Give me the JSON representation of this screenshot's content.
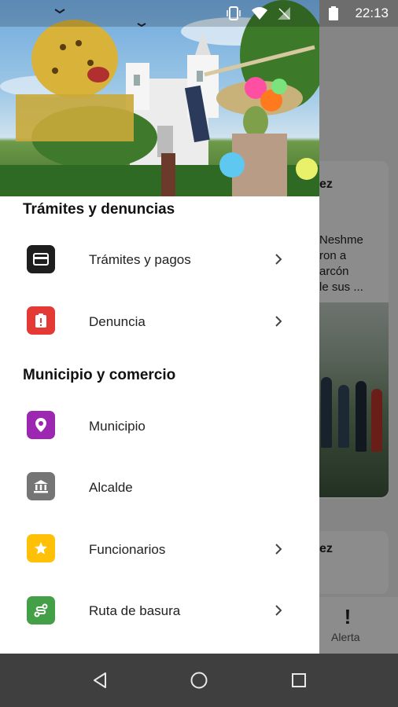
{
  "status_bar": {
    "time": "22:13"
  },
  "drawer": {
    "sections": [
      {
        "title": "Trámites y denuncias",
        "items": [
          {
            "label": "Trámites y pagos",
            "icon": "card-icon",
            "color": "#1e1e1e",
            "has_chevron": true
          },
          {
            "label": "Denuncia",
            "icon": "clipboard-alert-icon",
            "color": "#e53935",
            "has_chevron": true
          }
        ]
      },
      {
        "title": "Municipio y comercio",
        "items": [
          {
            "label": "Municipio",
            "icon": "location-pin-icon",
            "color": "#9c27b0",
            "has_chevron": false
          },
          {
            "label": "Alcalde",
            "icon": "bank-icon",
            "color": "#757575",
            "has_chevron": false
          },
          {
            "label": "Funcionarios",
            "icon": "star-icon",
            "color": "#ffc107",
            "has_chevron": true
          },
          {
            "label": "Ruta de basura",
            "icon": "route-icon",
            "color": "#43a047",
            "has_chevron": true
          }
        ]
      }
    ]
  },
  "background": {
    "card1_title": "ez",
    "card1_lines": [
      "Neshme",
      "ron a",
      "arcón",
      "le sus ..."
    ],
    "card2_title": "ez",
    "bottom_tab_label": "Alerta"
  }
}
